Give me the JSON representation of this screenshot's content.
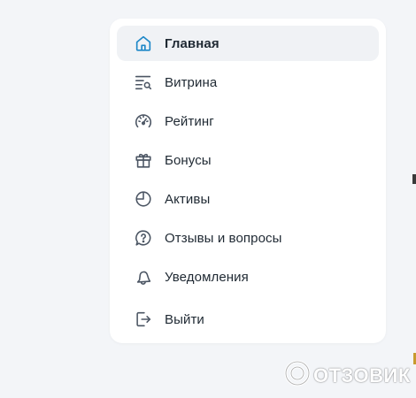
{
  "menu": {
    "items": [
      {
        "label": "Главная",
        "icon": "home-icon",
        "active": true
      },
      {
        "label": "Витрина",
        "icon": "list-search-icon",
        "active": false
      },
      {
        "label": "Рейтинг",
        "icon": "speedometer-icon",
        "active": false
      },
      {
        "label": "Бонусы",
        "icon": "gift-icon",
        "active": false
      },
      {
        "label": "Активы",
        "icon": "pie-chart-icon",
        "active": false
      },
      {
        "label": "Отзывы и вопросы",
        "icon": "question-bubble-icon",
        "active": false
      },
      {
        "label": "Уведомления",
        "icon": "bell-icon",
        "active": false
      },
      {
        "label": "Выйти",
        "icon": "logout-icon",
        "active": false
      }
    ]
  },
  "watermark": {
    "text": "ОТЗОВИК"
  },
  "colors": {
    "page_background": "#f3f5f8",
    "active_item_background": "#f0f2f5",
    "active_icon": "#1e88c8",
    "icon": "#4b5563",
    "text": "#1f2933"
  }
}
